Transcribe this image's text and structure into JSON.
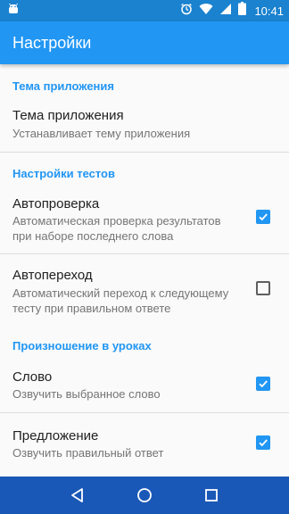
{
  "status_bar": {
    "time": "10:41",
    "icons": [
      "android-icon",
      "alarm-icon",
      "wifi-icon",
      "signal-icon",
      "battery-icon"
    ]
  },
  "app_bar": {
    "title": "Настройки"
  },
  "sections": {
    "theme": {
      "header": "Тема приложения",
      "items": [
        {
          "title": "Тема приложения",
          "summary": "Устанавливает тему приложения"
        }
      ]
    },
    "tests": {
      "header": "Настройки тестов",
      "items": [
        {
          "title": "Автопроверка",
          "summary": "Автоматическая проверка результатов при наборе последнего слова",
          "checked": true
        },
        {
          "title": "Автопереход",
          "summary": "Автоматический переход к следующему тесту при правильном ответе",
          "checked": false
        }
      ]
    },
    "pronunciation": {
      "header": "Произношение в уроках",
      "items": [
        {
          "title": "Слово",
          "summary": "Озвучить выбранное слово",
          "checked": true
        },
        {
          "title": "Предложение",
          "summary": "Озвучить правильный ответ",
          "checked": true
        }
      ]
    }
  },
  "nav_bar": {
    "buttons": [
      "back-icon",
      "home-icon",
      "recents-icon"
    ]
  },
  "colors": {
    "primary": "#2196f3",
    "primary_dark": "#1a82cf",
    "nav_bar": "#1a58b7"
  }
}
